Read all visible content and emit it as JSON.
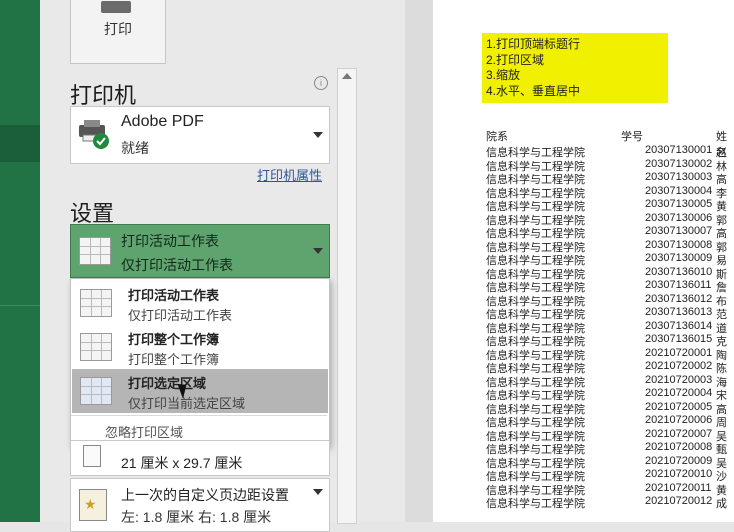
{
  "print_button": {
    "label": "打印"
  },
  "printer": {
    "section_title": "打印机",
    "info_icon": "i",
    "name": "Adobe PDF",
    "status": "就绪",
    "properties_link": "打印机属性"
  },
  "settings": {
    "section_title": "设置",
    "scope_selected": {
      "title": "打印活动工作表",
      "subtitle": "仅打印活动工作表"
    },
    "scope_menu": [
      {
        "title": "打印活动工作表",
        "subtitle": "仅打印活动工作表"
      },
      {
        "title": "打印整个工作簿",
        "subtitle": "打印整个工作簿"
      },
      {
        "title": "打印选定区域",
        "subtitle": "仅打印当前选定区域"
      }
    ],
    "ignore_print_area": "忽略打印区域",
    "paper_size": "21 厘米 x 29.7 厘米",
    "margins": {
      "title": "上一次的自定义页边距设置",
      "detail": "左: 1.8 厘米    右: 1.8 厘米"
    }
  },
  "preview": {
    "note_lines": [
      "1.打印顶端标题行",
      "2.打印区域",
      "3.缩放",
      "4.水平、垂直居中"
    ],
    "headers": [
      "院系",
      "学号",
      "姓名"
    ],
    "rows": [
      [
        "信息科学与工程学院",
        "20307130001",
        "赵"
      ],
      [
        "信息科学与工程学院",
        "20307130002",
        "林"
      ],
      [
        "信息科学与工程学院",
        "20307130003",
        "高"
      ],
      [
        "信息科学与工程学院",
        "20307130004",
        "李"
      ],
      [
        "信息科学与工程学院",
        "20307130005",
        "黄"
      ],
      [
        "信息科学与工程学院",
        "20307130006",
        "郭"
      ],
      [
        "信息科学与工程学院",
        "20307130007",
        "高"
      ],
      [
        "信息科学与工程学院",
        "20307130008",
        "郭"
      ],
      [
        "信息科学与工程学院",
        "20307130009",
        "易"
      ],
      [
        "信息科学与工程学院",
        "20307136010",
        "斯"
      ],
      [
        "信息科学与工程学院",
        "20307136011",
        "詹"
      ],
      [
        "信息科学与工程学院",
        "20307136012",
        "布"
      ],
      [
        "信息科学与工程学院",
        "20307136013",
        "范"
      ],
      [
        "信息科学与工程学院",
        "20307136014",
        "道"
      ],
      [
        "信息科学与工程学院",
        "20307136015",
        "克"
      ],
      [
        "信息科学与工程学院",
        "20210720001",
        "陶"
      ],
      [
        "信息科学与工程学院",
        "20210720002",
        "陈"
      ],
      [
        "信息科学与工程学院",
        "20210720003",
        "海"
      ],
      [
        "信息科学与工程学院",
        "20210720004",
        "宋"
      ],
      [
        "信息科学与工程学院",
        "20210720005",
        "高"
      ],
      [
        "信息科学与工程学院",
        "20210720006",
        "周"
      ],
      [
        "信息科学与工程学院",
        "20210720007",
        "吴"
      ],
      [
        "信息科学与工程学院",
        "20210720008",
        "甄"
      ],
      [
        "信息科学与工程学院",
        "20210720009",
        "吴"
      ],
      [
        "信息科学与工程学院",
        "20210720010",
        "沙"
      ],
      [
        "信息科学与工程学院",
        "20210720011",
        "黄"
      ],
      [
        "信息科学与工程学院",
        "20210720012",
        "成"
      ]
    ]
  },
  "colors": {
    "excel_green": "#217346",
    "selected_green": "#5fa36f",
    "note_yellow": "#f0f000"
  }
}
